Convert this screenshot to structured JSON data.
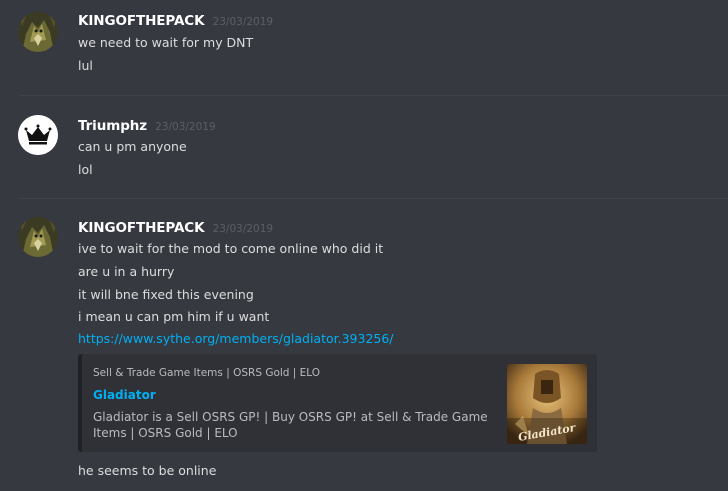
{
  "messages": [
    {
      "username": "KINGOFTHEPACK",
      "timestamp": "23/03/2019",
      "avatar_icon": "wolf-avatar-icon",
      "lines": [
        "we need to wait for my DNT",
        "lul"
      ]
    },
    {
      "username": "Triumphz",
      "timestamp": "23/03/2019",
      "avatar_icon": "crown-avatar-icon",
      "lines": [
        "can u pm anyone",
        "lol"
      ]
    },
    {
      "username": "KINGOFTHEPACK",
      "timestamp": "23/03/2019",
      "avatar_icon": "wolf-avatar-icon",
      "lines": [
        "ive to wait for the mod to come online who did it",
        "are u in a hurry",
        "it will bne fixed this evening",
        "i mean u can pm him if u want"
      ],
      "link": "https://www.sythe.org/members/gladiator.393256/",
      "embed": {
        "provider": "Sell & Trade Game Items | OSRS Gold | ELO",
        "title": "Gladiator",
        "description": "Gladiator is a Sell OSRS GP! | Buy OSRS GP! at Sell & Trade Game Items | OSRS Gold | ELO",
        "thumbnail_caption": "Gladiator"
      },
      "after_embed": "he seems to  be online"
    }
  ],
  "colors": {
    "background": "#36393f",
    "username": "#ffffff",
    "timestamp": "#5b5e64",
    "message_text": "#dcddde",
    "link": "#00b0f4",
    "embed_background": "#2f3136"
  }
}
